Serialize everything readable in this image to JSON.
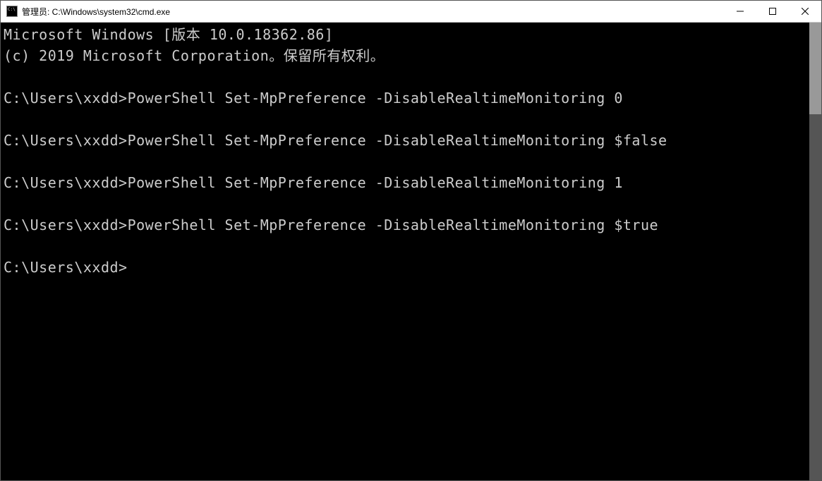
{
  "window": {
    "title": "管理员: C:\\Windows\\system32\\cmd.exe",
    "icon": "cmd-icon"
  },
  "controls": {
    "minimize": "minimize",
    "maximize": "maximize",
    "close": "close"
  },
  "terminal": {
    "header_line1": "Microsoft Windows [版本 10.0.18362.86]",
    "header_line2": "(c) 2019 Microsoft Corporation。保留所有权利。",
    "prompt": "C:\\Users\\xxdd>",
    "commands": [
      {
        "prompt": "C:\\Users\\xxdd>",
        "input": "PowerShell Set-MpPreference -DisableRealtimeMonitoring 0"
      },
      {
        "prompt": "C:\\Users\\xxdd>",
        "input": "PowerShell Set-MpPreference -DisableRealtimeMonitoring $false"
      },
      {
        "prompt": "C:\\Users\\xxdd>",
        "input": "PowerShell Set-MpPreference -DisableRealtimeMonitoring 1"
      },
      {
        "prompt": "C:\\Users\\xxdd>",
        "input": "PowerShell Set-MpPreference -DisableRealtimeMonitoring $true"
      }
    ],
    "current_prompt": "C:\\Users\\xxdd>",
    "current_input": ""
  }
}
